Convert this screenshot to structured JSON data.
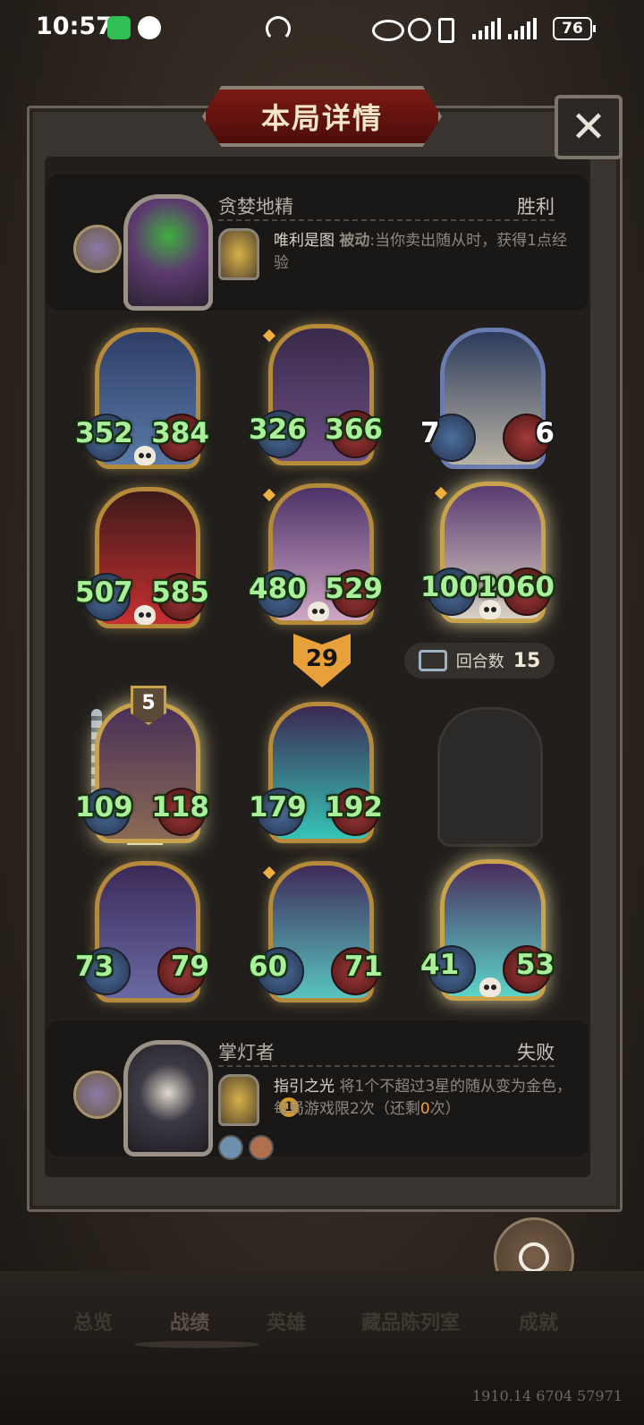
{
  "status_bar": {
    "time": "10:57",
    "battery": "76"
  },
  "title": "本局详情",
  "close_label": "✕",
  "top_hero": {
    "name": "贪婪地精",
    "result": "胜利",
    "power_name": "唯利是图",
    "power_keyword": "被动",
    "power_desc": ":当你卖出随从时，获得1点经验"
  },
  "top_board": [
    {
      "atk": "352",
      "hp": "384",
      "frame": "gold",
      "art": "whale",
      "skull": true,
      "gem": false
    },
    {
      "atk": "326",
      "hp": "366",
      "frame": "gold",
      "art": "squid-pirate",
      "skull": false,
      "gem": true
    },
    {
      "atk": "7",
      "hp": "6",
      "frame": "silver",
      "art": "seagull",
      "skull": false,
      "gem": false,
      "white": true
    },
    {
      "atk": "507",
      "hp": "585",
      "frame": "gold",
      "art": "octopus",
      "skull": true,
      "gem": false
    },
    {
      "atk": "480",
      "hp": "529",
      "frame": "gold",
      "art": "pig",
      "skull": true,
      "gem": true
    },
    {
      "atk": "1002",
      "hp": "1060",
      "frame": "golden",
      "art": "bird",
      "skull": true,
      "gem": true
    }
  ],
  "round_indicator": "29",
  "rounds_label": "回合数",
  "rounds_value": "15",
  "bottom_board": [
    {
      "atk": "109",
      "hp": "118",
      "frame": "golden",
      "art": "pirate",
      "tier": "5"
    },
    {
      "atk": "179",
      "hp": "192",
      "frame": "gold",
      "art": "ghost-king"
    },
    {
      "atk": "73",
      "hp": "79",
      "frame": "gold",
      "art": "wizard-girl"
    },
    {
      "atk": "60",
      "hp": "71",
      "frame": "gold",
      "art": "ghost-pirate",
      "gem": true
    },
    {
      "atk": "41",
      "hp": "53",
      "frame": "golden",
      "art": "ghost-lady",
      "skull": true
    }
  ],
  "bottom_hero": {
    "name": "掌灯者",
    "result": "失败",
    "power_name": "指引之光",
    "power_desc_a": "将1个不超过3星的随从变为金色，每局游戏限2次（还剩",
    "power_remaining": "0",
    "power_desc_b": "次）",
    "power_cost": "1"
  },
  "share_label": "分享",
  "nav": [
    "总览",
    "战绩",
    "英雄",
    "藏品陈列室",
    "成就"
  ],
  "footer_id": "1910.14 6704 57971",
  "colors": {
    "stat_green": "#a8f09a",
    "title_red": "#7a1a14",
    "gold_frame": "#b58a3a"
  }
}
